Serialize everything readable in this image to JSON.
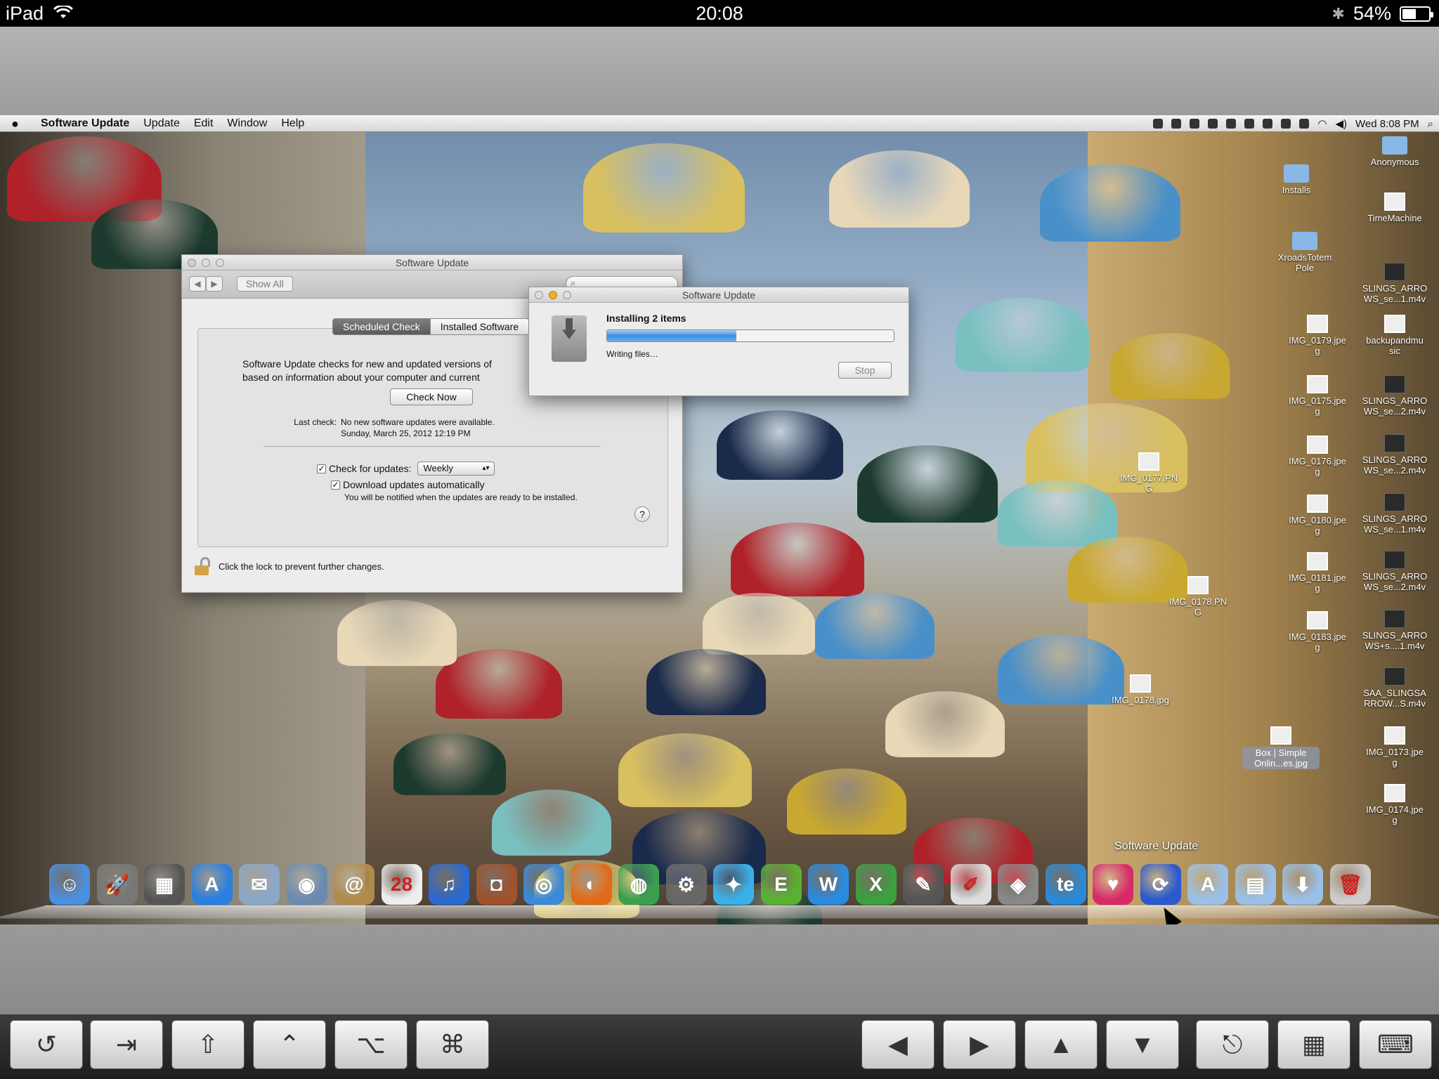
{
  "ipad_status": {
    "device": "iPad",
    "time": "20:08",
    "battery": "54%",
    "battery_level": 0.54
  },
  "menubar": {
    "app_name": "Software Update",
    "menus": [
      "Update",
      "Edit",
      "Window",
      "Help"
    ],
    "clock": "Wed 8:08 PM"
  },
  "prefs_window": {
    "title": "Software Update",
    "show_all": "Show All",
    "tabs": [
      "Scheduled Check",
      "Installed Software"
    ],
    "description_line1": "Software Update checks for new and updated versions of",
    "description_line2": "based on information about your computer and current",
    "check_now": "Check Now",
    "last_check_label": "Last check:",
    "last_check_value1": "No new software updates were available.",
    "last_check_value2": "Sunday, March 25, 2012 12:19 PM",
    "check_for_updates_label": "Check for updates:",
    "check_frequency": "Weekly",
    "download_label": "Download updates automatically",
    "download_note": "You will be notified when the updates are ready to be installed.",
    "help": "?",
    "lock_text": "Click the lock to prevent further changes."
  },
  "install_window": {
    "title": "Software Update",
    "heading": "Installing 2 items",
    "status": "Writing files…",
    "progress": 0.45,
    "stop": "Stop"
  },
  "desktop_icons": [
    {
      "label": "Anonymous",
      "kind": "folder"
    },
    {
      "label": "Installs",
      "kind": "folder"
    },
    {
      "label": "TimeMachine",
      "kind": "doc"
    },
    {
      "label": "XroadsTotem\nPole",
      "kind": "folder"
    },
    {
      "label": "SLINGS_ARRO\nWS_se...1.m4v",
      "kind": "movie"
    },
    {
      "label": "IMG_0179.jpe\ng",
      "kind": "doc"
    },
    {
      "label": "backupandmu\nsic",
      "kind": "doc"
    },
    {
      "label": "IMG_0175.jpe\ng",
      "kind": "doc"
    },
    {
      "label": "SLINGS_ARRO\nWS_se...2.m4v",
      "kind": "movie"
    },
    {
      "label": "IMG_0177.PN\nG",
      "kind": "doc"
    },
    {
      "label": "IMG_0176.jpe\ng",
      "kind": "doc"
    },
    {
      "label": "SLINGS_ARRO\nWS_se...2.m4v",
      "kind": "movie"
    },
    {
      "label": "IMG_0180.jpe\ng",
      "kind": "doc"
    },
    {
      "label": "SLINGS_ARRO\nWS_se...1.m4v",
      "kind": "movie"
    },
    {
      "label": "IMG_0181.jpe\ng",
      "kind": "doc"
    },
    {
      "label": "SLINGS_ARRO\nWS_se...2.m4v",
      "kind": "movie"
    },
    {
      "label": "IMG_0178.PN\nG",
      "kind": "doc"
    },
    {
      "label": "IMG_0183.jpe\ng",
      "kind": "doc"
    },
    {
      "label": "SLINGS_ARRO\nWS+s....1.m4v",
      "kind": "movie"
    },
    {
      "label": "IMG_0178.jpg",
      "kind": "doc"
    },
    {
      "label": "SAA_SLINGSA\nRROW...S.m4v",
      "kind": "movie"
    },
    {
      "label": "Box | Simple\nOnlin...es.jpg",
      "kind": "doc"
    },
    {
      "label": "IMG_0173.jpe\ng",
      "kind": "doc"
    },
    {
      "label": "IMG_0174.jpe\ng",
      "kind": "doc"
    }
  ],
  "dock": {
    "hover_label": "Software Update",
    "items": [
      {
        "name": "finder-icon",
        "glyph": "☺",
        "color": "#4a8fe0"
      },
      {
        "name": "launchpad-icon",
        "glyph": "🚀",
        "color": "#777"
      },
      {
        "name": "image-capture-icon",
        "glyph": "▦",
        "color": "#555"
      },
      {
        "name": "app-store-icon",
        "glyph": "A",
        "color": "#2a7fe0"
      },
      {
        "name": "mail-icon",
        "glyph": "✉",
        "color": "#8aa8c8"
      },
      {
        "name": "preview-icon",
        "glyph": "◉",
        "color": "#6a8ab0"
      },
      {
        "name": "address-book-icon",
        "glyph": "@",
        "color": "#b08a4a"
      },
      {
        "name": "calendar-icon",
        "glyph": "28",
        "color": "#eee"
      },
      {
        "name": "itunes-icon",
        "glyph": "♫",
        "color": "#2a6ad0"
      },
      {
        "name": "photo-booth-icon",
        "glyph": "◘",
        "color": "#a0522d"
      },
      {
        "name": "safari-icon",
        "glyph": "◎",
        "color": "#3a8ad8"
      },
      {
        "name": "firefox-icon",
        "glyph": "◐",
        "color": "#e06a1a"
      },
      {
        "name": "chrome-icon",
        "glyph": "◍",
        "color": "#3aa050"
      },
      {
        "name": "system-preferences-icon",
        "glyph": "⚙",
        "color": "#666"
      },
      {
        "name": "twitter-icon",
        "glyph": "✦",
        "color": "#3ab0e8"
      },
      {
        "name": "evernote-icon",
        "glyph": "E",
        "color": "#5ab030"
      },
      {
        "name": "word-icon",
        "glyph": "W",
        "color": "#2a8ae0"
      },
      {
        "name": "excel-icon",
        "glyph": "X",
        "color": "#3aa040"
      },
      {
        "name": "quill-icon",
        "glyph": "✎",
        "color": "#555"
      },
      {
        "name": "textedit-icon",
        "glyph": "✐",
        "color": "#ddd"
      },
      {
        "name": "network-utility-icon",
        "glyph": "◈",
        "color": "#888"
      },
      {
        "name": "te-icon",
        "glyph": "te",
        "color": "#2a8ad8"
      },
      {
        "name": "heart-app-icon",
        "glyph": "♥",
        "color": "#d82a6a"
      },
      {
        "name": "software-update-icon",
        "glyph": "⟳",
        "color": "#2a5ad0"
      },
      {
        "name": "applications-folder-icon",
        "glyph": "A",
        "color": "#9ac0e8"
      },
      {
        "name": "documents-folder-icon",
        "glyph": "▤",
        "color": "#9ac0e8"
      },
      {
        "name": "downloads-folder-icon",
        "glyph": "⬇",
        "color": "#9ac0e8"
      },
      {
        "name": "trash-icon",
        "glyph": "🗑",
        "color": "#ccc"
      }
    ]
  },
  "keyboard_bar": {
    "keys": [
      {
        "name": "history-key",
        "glyph": "↺"
      },
      {
        "name": "tab-key",
        "glyph": "⇥"
      },
      {
        "name": "shift-key",
        "glyph": "⇧"
      },
      {
        "name": "control-key",
        "glyph": "⌃"
      },
      {
        "name": "option-key",
        "glyph": "⌥"
      },
      {
        "name": "command-key",
        "glyph": "⌘"
      },
      {
        "name": "arrow-left-key",
        "glyph": "◀"
      },
      {
        "name": "arrow-right-key",
        "glyph": "▶"
      },
      {
        "name": "arrow-up-key",
        "glyph": "▲"
      },
      {
        "name": "arrow-down-key",
        "glyph": "▼"
      },
      {
        "name": "share-key",
        "glyph": "⎋"
      },
      {
        "name": "grid-key",
        "glyph": "▦"
      },
      {
        "name": "keyboard-key",
        "glyph": "⌨"
      }
    ]
  }
}
